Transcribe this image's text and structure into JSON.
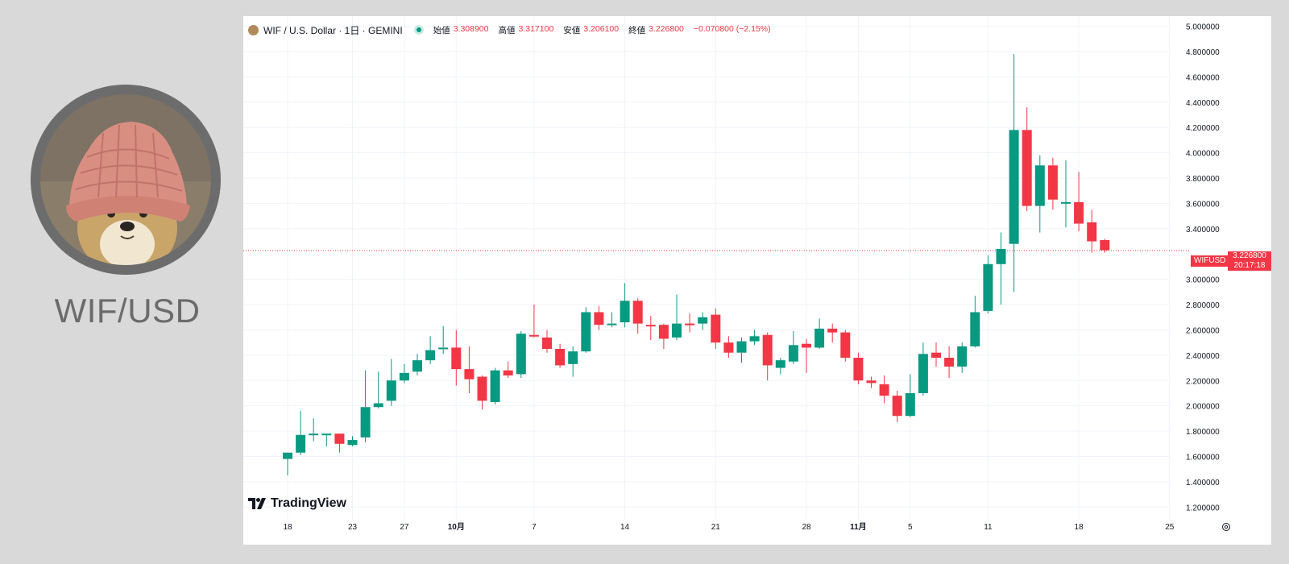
{
  "pair_title": "WIF/USD",
  "legend": {
    "symbol": "WIF / U.S. Dollar · 1日 · GEMINI",
    "open_label": "始値",
    "open": "3.308900",
    "high_label": "高値",
    "high": "3.317100",
    "low_label": "安値",
    "low": "3.206100",
    "close_label": "終値",
    "close": "3.226800",
    "change": "−0.070800 (−2.15%)"
  },
  "watermark": "TradingView",
  "price_tag": {
    "symbol": "WIFUSD",
    "price": "3.226800",
    "countdown": "20:17:18"
  },
  "colors": {
    "up": "#089981",
    "down": "#f23645",
    "grid": "#f0f3fa",
    "text": "#131722"
  },
  "chart_data": {
    "type": "candlestick",
    "title": "",
    "ylim": [
      1.1,
      5.08
    ],
    "yticks": [
      "5.000000",
      "4.800000",
      "4.600000",
      "4.400000",
      "4.200000",
      "4.000000",
      "3.800000",
      "3.600000",
      "3.400000",
      "3.000000",
      "2.800000",
      "2.600000",
      "2.400000",
      "2.200000",
      "2.000000",
      "1.800000",
      "1.600000",
      "1.400000",
      "1.200000"
    ],
    "xticks": [
      {
        "label": "18",
        "index": 0,
        "bold": false
      },
      {
        "label": "23",
        "index": 5,
        "bold": false
      },
      {
        "label": "27",
        "index": 9,
        "bold": false
      },
      {
        "label": "10月",
        "index": 13,
        "bold": true
      },
      {
        "label": "7",
        "index": 19,
        "bold": false
      },
      {
        "label": "14",
        "index": 26,
        "bold": false
      },
      {
        "label": "21",
        "index": 33,
        "bold": false
      },
      {
        "label": "28",
        "index": 40,
        "bold": false
      },
      {
        "label": "11月",
        "index": 44,
        "bold": true
      },
      {
        "label": "5",
        "index": 48,
        "bold": false
      },
      {
        "label": "11",
        "index": 54,
        "bold": false
      },
      {
        "label": "18",
        "index": 61,
        "bold": false
      },
      {
        "label": "25",
        "index": 68,
        "bold": false
      }
    ],
    "last_price": 3.2268,
    "candles": [
      [
        1.58,
        1.63,
        1.45,
        1.63
      ],
      [
        1.63,
        1.77,
        1.61,
        1.96
      ],
      [
        1.77,
        1.78,
        1.72,
        1.9
      ],
      [
        1.78,
        1.78,
        1.68,
        1.78
      ],
      [
        1.78,
        1.7,
        1.63,
        1.78
      ],
      [
        1.69,
        1.73,
        1.68,
        1.76
      ],
      [
        1.75,
        1.99,
        1.71,
        2.28
      ],
      [
        1.99,
        2.02,
        1.98,
        2.27
      ],
      [
        2.04,
        2.2,
        2.0,
        2.37
      ],
      [
        2.2,
        2.26,
        2.18,
        2.33
      ],
      [
        2.27,
        2.36,
        2.24,
        2.41
      ],
      [
        2.36,
        2.44,
        2.33,
        2.55
      ],
      [
        2.45,
        2.46,
        2.41,
        2.63
      ],
      [
        2.46,
        2.29,
        2.16,
        2.6
      ],
      [
        2.29,
        2.21,
        2.1,
        2.47
      ],
      [
        2.23,
        2.04,
        1.97,
        2.24
      ],
      [
        2.03,
        2.28,
        2.01,
        2.3
      ],
      [
        2.28,
        2.24,
        2.22,
        2.35
      ],
      [
        2.25,
        2.57,
        2.22,
        2.59
      ],
      [
        2.56,
        2.55,
        2.54,
        2.8
      ],
      [
        2.54,
        2.45,
        2.42,
        2.6
      ],
      [
        2.45,
        2.32,
        2.3,
        2.49
      ],
      [
        2.33,
        2.43,
        2.23,
        2.47
      ],
      [
        2.43,
        2.74,
        2.42,
        2.78
      ],
      [
        2.74,
        2.64,
        2.6,
        2.79
      ],
      [
        2.65,
        2.65,
        2.62,
        2.74
      ],
      [
        2.66,
        2.83,
        2.62,
        2.97
      ],
      [
        2.83,
        2.65,
        2.57,
        2.85
      ],
      [
        2.64,
        2.63,
        2.52,
        2.71
      ],
      [
        2.64,
        2.53,
        2.45,
        2.65
      ],
      [
        2.54,
        2.65,
        2.52,
        2.88
      ],
      [
        2.65,
        2.64,
        2.58,
        2.73
      ],
      [
        2.65,
        2.7,
        2.6,
        2.74
      ],
      [
        2.72,
        2.5,
        2.45,
        2.77
      ],
      [
        2.5,
        2.42,
        2.38,
        2.55
      ],
      [
        2.42,
        2.51,
        2.34,
        2.54
      ],
      [
        2.51,
        2.55,
        2.48,
        2.6
      ],
      [
        2.56,
        2.32,
        2.2,
        2.58
      ],
      [
        2.3,
        2.36,
        2.25,
        2.38
      ],
      [
        2.35,
        2.48,
        2.33,
        2.59
      ],
      [
        2.49,
        2.46,
        2.26,
        2.53
      ],
      [
        2.46,
        2.61,
        2.45,
        2.69
      ],
      [
        2.61,
        2.58,
        2.5,
        2.65
      ],
      [
        2.58,
        2.38,
        2.35,
        2.6
      ],
      [
        2.38,
        2.2,
        2.17,
        2.42
      ],
      [
        2.2,
        2.18,
        2.14,
        2.23
      ],
      [
        2.17,
        2.08,
        2.02,
        2.24
      ],
      [
        2.08,
        1.92,
        1.87,
        2.12
      ],
      [
        1.92,
        2.1,
        1.91,
        2.25
      ],
      [
        2.1,
        2.41,
        2.08,
        2.5
      ],
      [
        2.42,
        2.38,
        2.31,
        2.5
      ],
      [
        2.38,
        2.31,
        2.22,
        2.47
      ],
      [
        2.31,
        2.47,
        2.26,
        2.5
      ],
      [
        2.47,
        2.74,
        2.46,
        2.87
      ],
      [
        2.75,
        3.12,
        2.73,
        3.19
      ],
      [
        3.12,
        3.24,
        2.8,
        3.37
      ],
      [
        3.28,
        4.18,
        2.9,
        4.78
      ],
      [
        4.18,
        3.58,
        3.54,
        4.36
      ],
      [
        3.58,
        3.9,
        3.37,
        3.98
      ],
      [
        3.9,
        3.63,
        3.55,
        3.96
      ],
      [
        3.61,
        3.61,
        3.41,
        3.94
      ],
      [
        3.61,
        3.44,
        3.38,
        3.85
      ],
      [
        3.45,
        3.3,
        3.21,
        3.55
      ],
      [
        3.31,
        3.23,
        3.21,
        3.32
      ]
    ]
  }
}
